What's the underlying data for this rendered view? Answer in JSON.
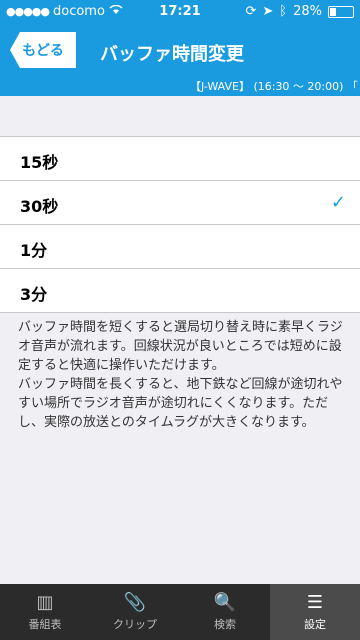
{
  "status_bar": {
    "carrier": "docomo",
    "time": "17:21",
    "battery_percent": "28%"
  },
  "header": {
    "back_label": "もどる",
    "title": "バッファ時間変更",
    "ticker": "【J-WAVE】 (16:30 ～ 20:00) 「"
  },
  "options": [
    {
      "label": "15秒",
      "selected": false
    },
    {
      "label": "30秒",
      "selected": true
    },
    {
      "label": "1分",
      "selected": false
    },
    {
      "label": "3分",
      "selected": false
    }
  ],
  "description": "バッファ時間を短くすると選局切り替え時に素早くラジオ音声が流れます。回線状況が良いところでは短めに設定すると快適に操作いただけます。\nバッファ時間を長くすると、地下鉄など回線が途切れやすい場所でラジオ音声が途切れにくくなります。ただし、実際の放送とのタイムラグが大きくなります。",
  "tabbar": {
    "tabs": [
      {
        "label": "番組表",
        "icon": "grid-icon"
      },
      {
        "label": "クリップ",
        "icon": "paperclip-icon"
      },
      {
        "label": "検索",
        "icon": "search-icon"
      },
      {
        "label": "設定",
        "icon": "menu-icon",
        "active": true
      }
    ]
  },
  "colors": {
    "accent": "#1a9be0",
    "tabbar": "#2b2b2b"
  }
}
